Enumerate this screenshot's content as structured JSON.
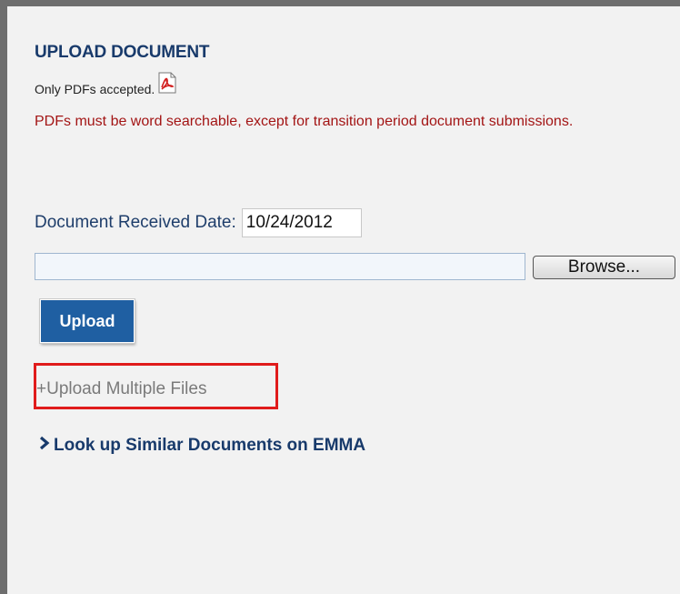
{
  "upload": {
    "title": "UPLOAD DOCUMENT",
    "only_pdfs": "Only PDFs accepted.",
    "pdf_icon": "pdf-file-icon",
    "warning": "PDFs must be word searchable, except for transition period document submissions.",
    "date_label": "Document Received Date:",
    "date_value": "10/24/2012",
    "file_value": "",
    "browse_label": "Browse...",
    "upload_label": "Upload",
    "multi_link": "+Upload Multiple Files",
    "chevron_icon": "chevron-right-icon",
    "emma_link": "Look up Similar Documents on EMMA"
  },
  "colors": {
    "heading": "#183a6b",
    "warning": "#a31515",
    "button": "#1f5fa2",
    "highlight": "#e01b1b"
  }
}
